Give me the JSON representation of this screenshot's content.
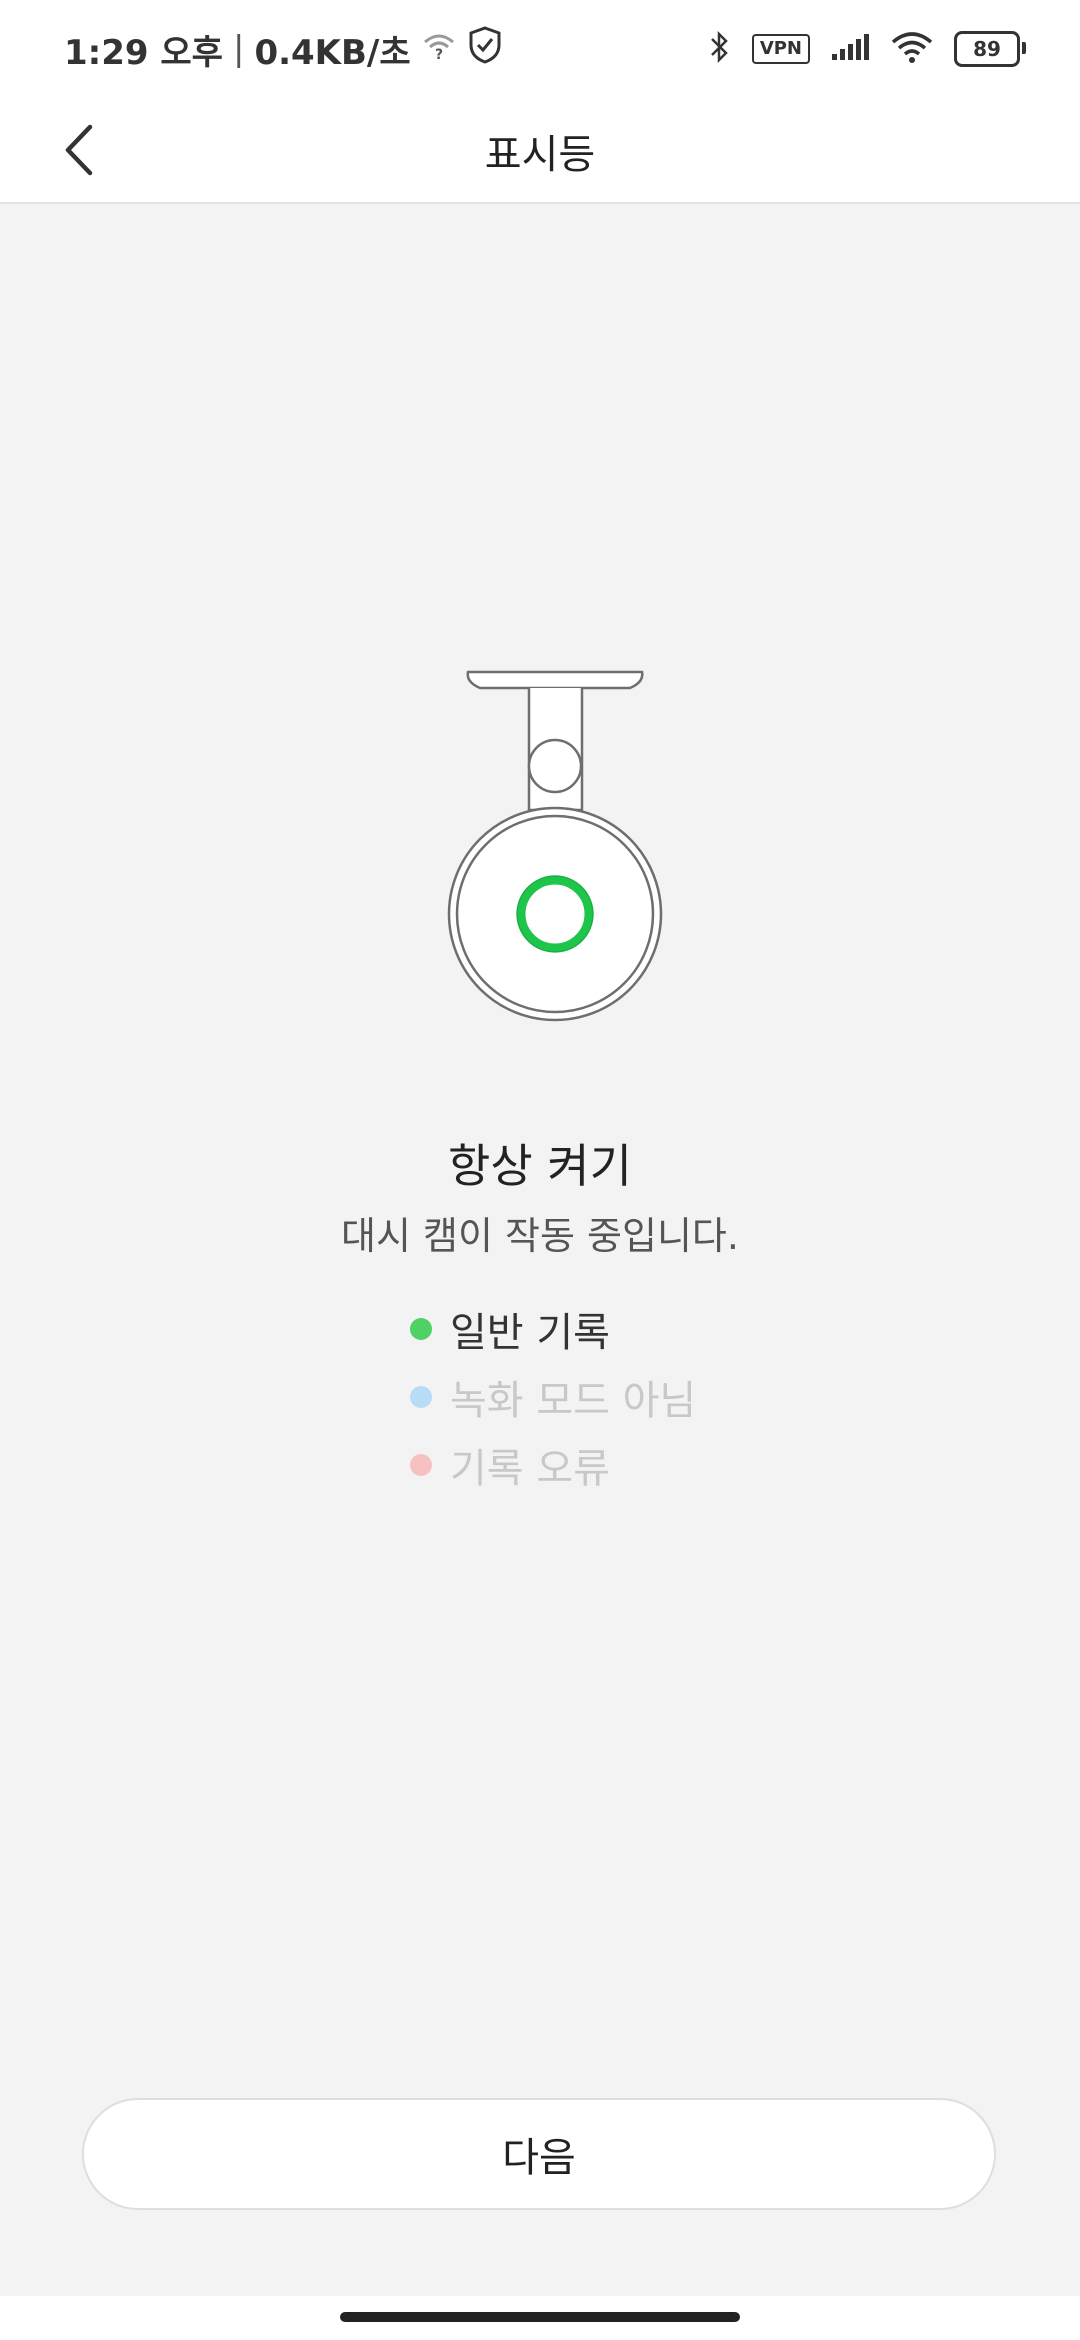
{
  "status_bar": {
    "time": "1:29 오후",
    "separator": "|",
    "net_speed": "0.4KB/초",
    "vpn_label": "VPN",
    "battery": "89",
    "icons": [
      "wifi-question-icon",
      "shield-check-icon",
      "bluetooth-icon",
      "signal-icon",
      "wifi-icon"
    ]
  },
  "header": {
    "title": "표시등",
    "back_icon": "chevron-left-icon"
  },
  "indicator": {
    "light_color": "#1fc44a",
    "title": "항상 켜기",
    "description": "대시 캠이 작동 중입니다."
  },
  "legend": [
    {
      "label": "일반 기록",
      "color": "#4dd263",
      "text_color": "#333333"
    },
    {
      "label": "녹화 모드 아님",
      "color": "#b8dcf5",
      "text_color": "#c8c8c8"
    },
    {
      "label": "기록 오류",
      "color": "#f6c1c1",
      "text_color": "#c8c8c8"
    }
  ],
  "next_button": {
    "label": "다음"
  }
}
